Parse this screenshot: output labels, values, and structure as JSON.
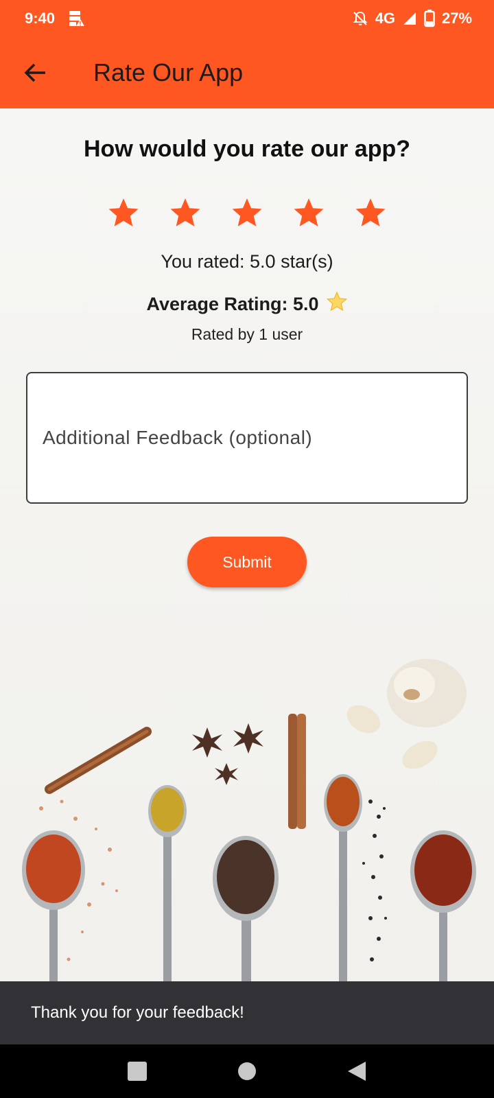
{
  "status_bar": {
    "time": "9:40",
    "network": "4G",
    "battery": "27%",
    "icons": [
      "data-saver-icon",
      "notifications-off-icon",
      "signal-icon",
      "battery-icon"
    ]
  },
  "app_bar": {
    "title": "Rate Our App",
    "back_icon": "arrow-back-icon"
  },
  "rating": {
    "question": "How would you rate our app?",
    "stars_total": 5,
    "stars_selected": 5,
    "you_rated": "You rated: 5.0 star(s)",
    "average_label": "Average Rating: 5.0",
    "average_emoji": "⭐",
    "rated_by": "Rated by 1 user"
  },
  "feedback": {
    "placeholder": "Additional Feedback (optional)",
    "value": ""
  },
  "submit_label": "Submit",
  "snackbar": {
    "message": "Thank you for your feedback!"
  },
  "colors": {
    "accent": "#ff5722",
    "snackbar_bg": "#323135"
  },
  "nav_bar": {
    "icons": [
      "recents-square-icon",
      "home-circle-icon",
      "back-triangle-icon"
    ]
  }
}
